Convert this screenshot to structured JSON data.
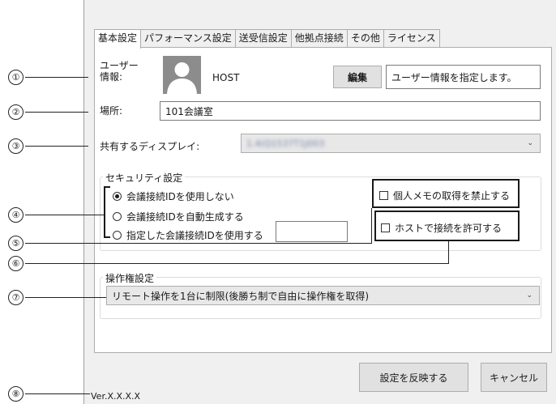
{
  "tabs": [
    "基本設定",
    "パフォーマンス設定",
    "送受信設定",
    "他拠点接続",
    "その他",
    "ライセンス"
  ],
  "user": {
    "label_line1": "ユーザー",
    "label_line2": "情報:",
    "name": "HOST",
    "edit_button": "編集",
    "info_text": "ユーザー情報を指定します。"
  },
  "location": {
    "label": "場所:",
    "value": "101会議室"
  },
  "display": {
    "label": "共有するディスプレイ:",
    "value": "1.4(Q1537T1J003"
  },
  "security": {
    "title": "セキュリティ設定",
    "options": [
      "会議接続IDを使用しない",
      "会議接続IDを自動生成する",
      "指定した会議接続IDを使用する"
    ],
    "selected_index": 0,
    "custom_id_value": "",
    "prohibit_memo_label": "個人メモの取得を禁止する",
    "prohibit_memo_checked": false,
    "allow_host_label": "ホストで接続を許可する",
    "allow_host_checked": false
  },
  "control": {
    "title": "操作権設定",
    "value": "リモート操作を1台に制限(後勝ち制で自由に操作権を取得)"
  },
  "footer": {
    "version": "Ver.X.X.X.X",
    "apply_button": "設定を反映する",
    "cancel_button": "キャンセル"
  },
  "callouts": [
    "①",
    "②",
    "③",
    "④",
    "⑤",
    "⑥",
    "⑦",
    "⑧"
  ],
  "icons": {
    "dropdown": "chevron-down-icon",
    "avatar": "user-avatar-icon"
  }
}
